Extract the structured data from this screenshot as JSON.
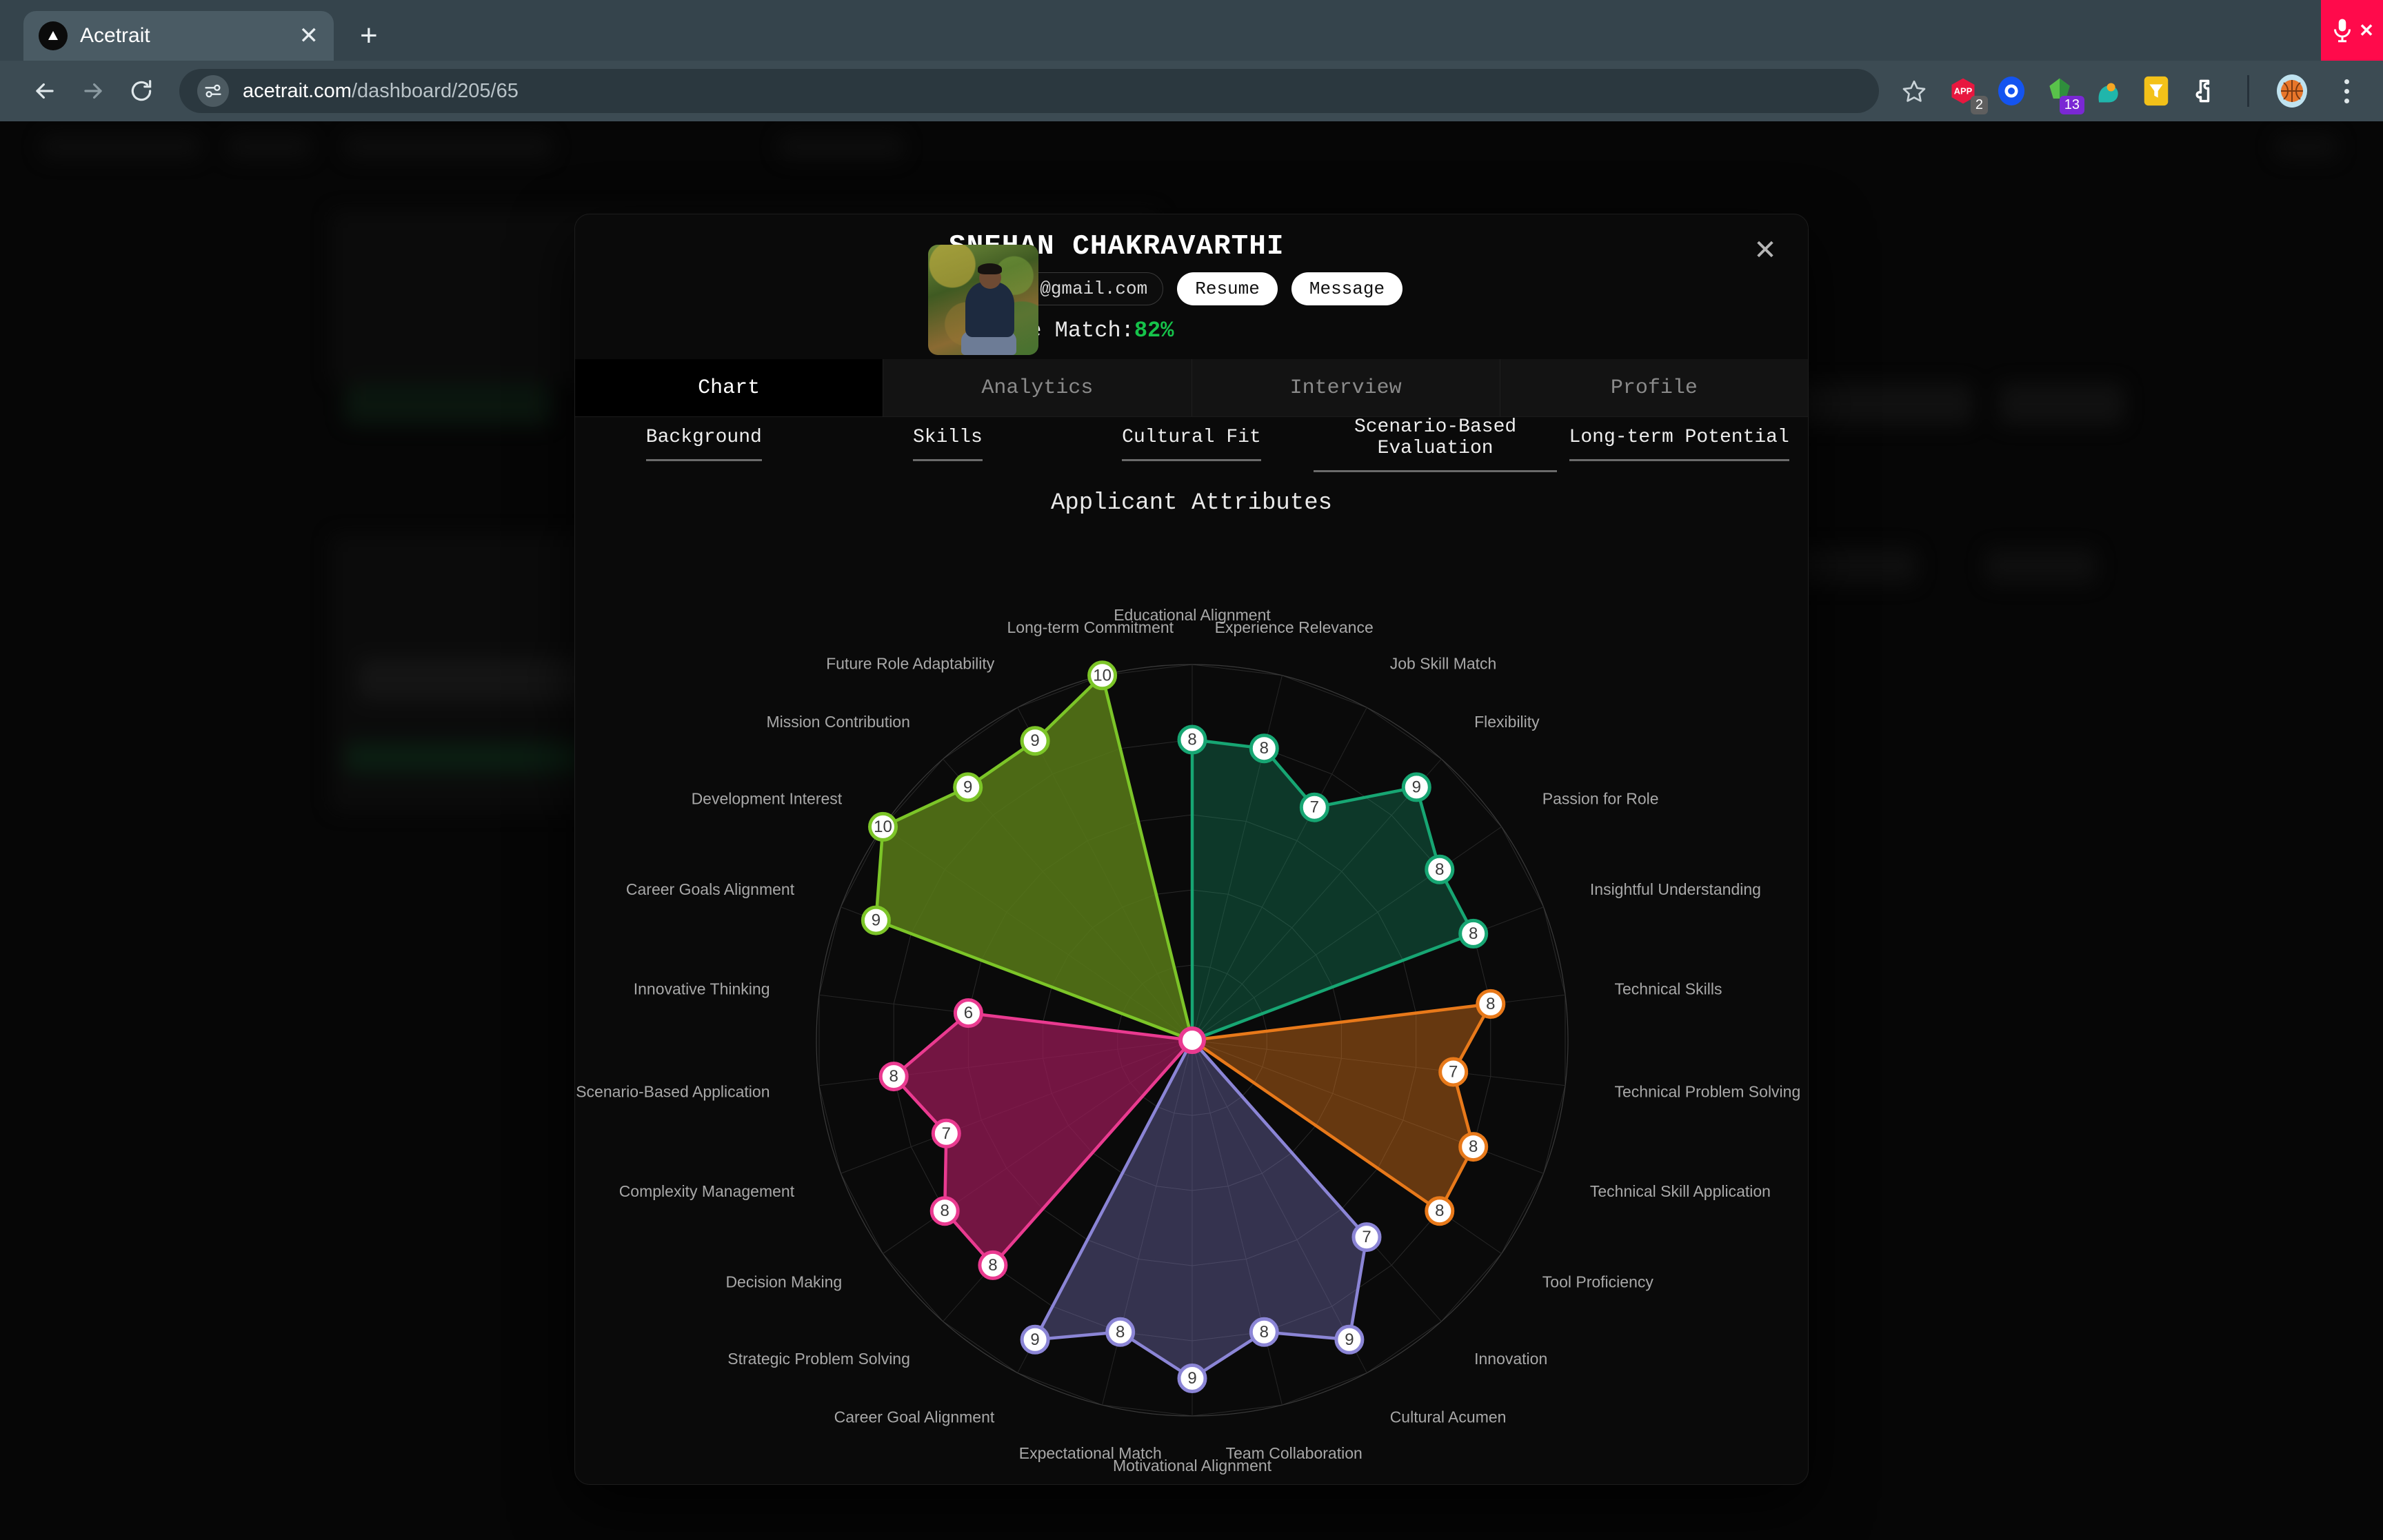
{
  "browser": {
    "tab_title": "Acetrait",
    "tab_close_label": "✕",
    "new_tab_label": "+",
    "url_host": "acetrait.com",
    "url_path": "/dashboard/205/65",
    "back_label": "←",
    "forward_label": "→",
    "reload_label": "⟳",
    "recording_x_label": "✕",
    "ext_badge_1": "2",
    "ext_badge_2": "13"
  },
  "modal": {
    "close_label": "✕",
    "candidate_name": "SNEHAN CHAKRAVARTHI",
    "email": "isnehan@gmail.com",
    "resume_label": "Resume",
    "message_label": "Message",
    "profile_match_label": "Profile Match:",
    "profile_match_value": "82%",
    "match_color": "#16c34a",
    "tabs": [
      {
        "label": "Chart",
        "active": true
      },
      {
        "label": "Analytics",
        "active": false
      },
      {
        "label": "Interview",
        "active": false
      },
      {
        "label": "Profile",
        "active": false
      }
    ],
    "subtabs": [
      {
        "label": "Background"
      },
      {
        "label": "Skills"
      },
      {
        "label": "Cultural Fit"
      },
      {
        "label": "Scenario-Based Evaluation"
      },
      {
        "label": "Long-term Potential"
      }
    ]
  },
  "chart_data": {
    "type": "radar",
    "title": "Applicant Attributes",
    "max": 10,
    "min": 0,
    "rings": 5,
    "grid": true,
    "legend": "none",
    "start_angle_deg": -90,
    "groups": [
      {
        "name": "Background",
        "color": "#17a673",
        "fill": "rgba(23,166,115,0.30)",
        "categories": [
          "Educational Alignment",
          "Experience Relevance",
          "Job Skill Match",
          "Flexibility",
          "Passion for Role",
          "Insightful Understanding"
        ],
        "values": [
          8,
          8,
          7,
          9,
          8,
          8
        ]
      },
      {
        "name": "Skills",
        "color": "#e8791a",
        "fill": "rgba(232,121,26,0.42)",
        "categories": [
          "Technical Skills",
          "Technical Problem Solving",
          "Technical Skill Application",
          "Tool Proficiency"
        ],
        "values": [
          8,
          7,
          8,
          8
        ]
      },
      {
        "name": "Cultural Fit",
        "color": "#8b85d6",
        "fill": "rgba(139,133,214,0.34)",
        "categories": [
          "Innovation",
          "Cultural Acumen",
          "Team Collaboration",
          "Motivational Alignment",
          "Expectational Match",
          "Career Goal Alignment"
        ],
        "values": [
          7,
          9,
          8,
          9,
          8,
          9
        ]
      },
      {
        "name": "Scenario-Based Evaluation",
        "color": "#ea3a90",
        "fill": "rgba(160,26,90,0.70)",
        "categories": [
          "Strategic Problem Solving",
          "Decision Making",
          "Complexity Management",
          "Scenario-Based Application",
          "Innovative Thinking"
        ],
        "values": [
          8,
          8,
          7,
          8,
          6
        ]
      },
      {
        "name": "Long-term Potential",
        "color": "#7cc528",
        "fill": "rgba(88,122,24,0.85)",
        "categories": [
          "Career Goals Alignment",
          "Development Interest",
          "Mission Contribution",
          "Future Role Adaptability",
          "Long-term Commitment"
        ],
        "values": [
          9,
          10,
          9,
          9,
          10
        ]
      }
    ]
  }
}
